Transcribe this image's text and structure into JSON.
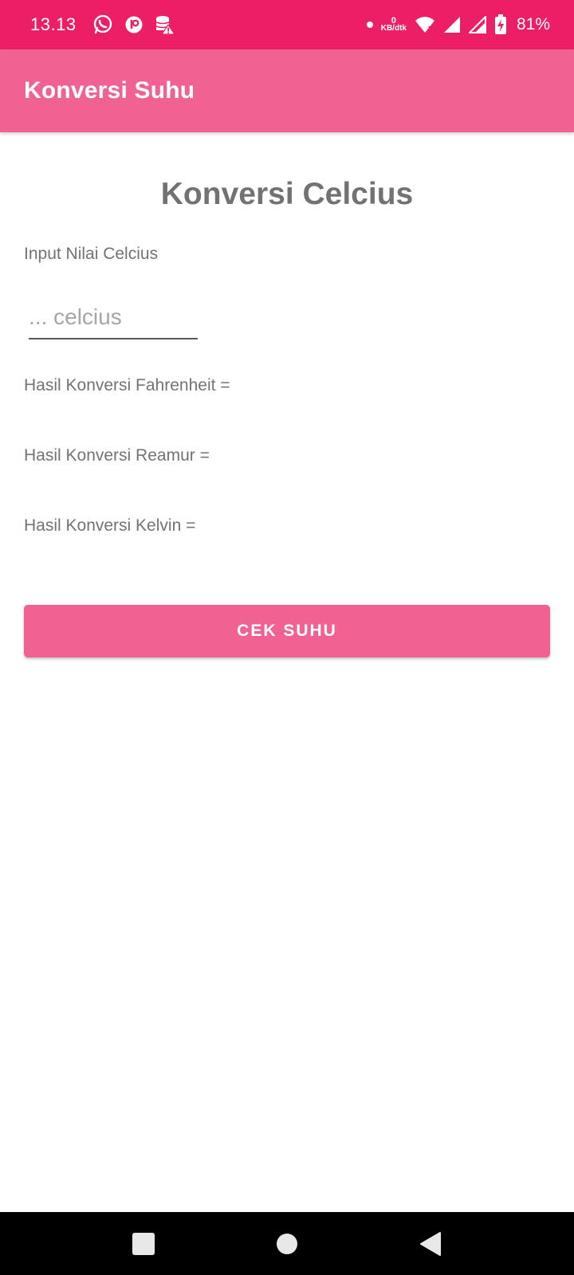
{
  "status_bar": {
    "time": "13.13",
    "net_speed_value": "0",
    "net_speed_unit": "KB/dtk",
    "battery_percent": "81%",
    "icons": [
      "whatsapp-icon",
      "app-icon",
      "storage-warning-icon",
      "dot-icon",
      "wifi-icon",
      "signal-icon",
      "signal-icon-2",
      "battery-charging-icon"
    ]
  },
  "app_bar": {
    "title": "Konversi Suhu",
    "color": "#F06292"
  },
  "main": {
    "heading": "Konversi Celcius",
    "input_label": "Input Nilai Celcius",
    "input_placeholder": "... celcius",
    "input_value": "",
    "results": {
      "fahrenheit_label": "Hasil Konversi Fahrenheit =",
      "reamur_label": "Hasil Konversi Reamur =",
      "kelvin_label": "Hasil Konversi Kelvin ="
    },
    "button_label": "CEK SUHU"
  },
  "nav_bar": {
    "icons": [
      "recents-square-icon",
      "home-circle-icon",
      "back-triangle-icon"
    ]
  },
  "colors": {
    "status_bar": "#EC1E66",
    "accent": "#F06292",
    "text_secondary": "#737373"
  }
}
